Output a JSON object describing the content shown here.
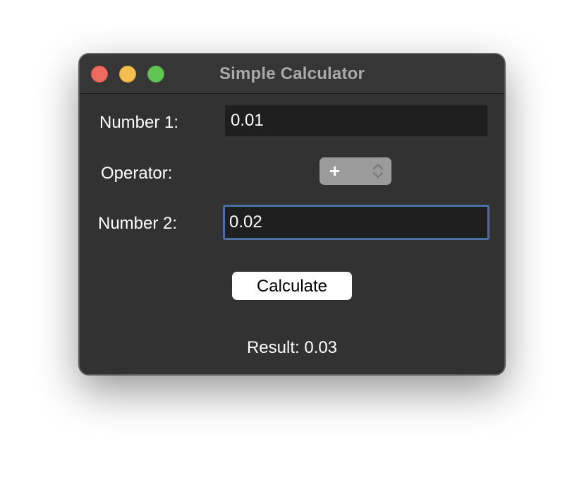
{
  "window": {
    "title": "Simple Calculator"
  },
  "form": {
    "number1_label": "Number 1:",
    "number1_value": "0.01",
    "operator_label": "Operator:",
    "operator_value": "+",
    "number2_label": "Number 2:",
    "number2_value": "0.02",
    "calculate_label": "Calculate",
    "result_text": "Result: 0.03"
  },
  "icons": {
    "close": "close-traffic-light",
    "minimize": "minimize-traffic-light",
    "zoom": "zoom-traffic-light",
    "select_arrows": "chevron-up-down-icon"
  },
  "colors": {
    "window_bg": "#323232",
    "field_bg": "#1f1f1f",
    "focus_ring": "#4a6fa3",
    "close": "#ed6a5e",
    "minimize": "#f5bf4f",
    "zoom": "#61c554"
  }
}
